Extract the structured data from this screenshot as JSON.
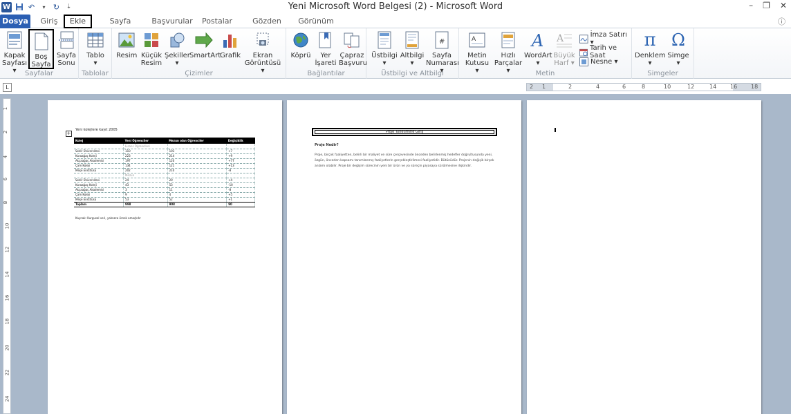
{
  "window": {
    "title": "Yeni Microsoft Word Belgesi (2) - Microsoft Word",
    "quick_access": [
      "word-logo",
      "save-icon",
      "undo-icon",
      "redo-icon",
      "customize-icon"
    ]
  },
  "tabs": [
    "Dosya",
    "Giriş",
    "Ekle",
    "Sayfa Düzeni",
    "Başvurular",
    "Postalar",
    "Gözden Geçir",
    "Görünüm"
  ],
  "active_tab": "Ekle",
  "ribbon": {
    "groups": {
      "pages": {
        "label": "Sayfalar",
        "buttons": [
          {
            "label1": "Kapak",
            "label2": "Sayfası ▾"
          },
          {
            "label1": "Boş",
            "label2": "Sayfa"
          },
          {
            "label1": "Sayfa",
            "label2": "Sonu"
          }
        ]
      },
      "tables": {
        "label": "Tablolar",
        "buttons": [
          {
            "label1": "Tablo",
            "label2": "▾"
          }
        ]
      },
      "illustrations": {
        "label": "Çizimler",
        "buttons": [
          {
            "label1": "Resim",
            "label2": ""
          },
          {
            "label1": "Küçük",
            "label2": "Resim"
          },
          {
            "label1": "Şekiller",
            "label2": "▾"
          },
          {
            "label1": "SmartArt",
            "label2": ""
          },
          {
            "label1": "Grafik",
            "label2": ""
          },
          {
            "label1": "Ekran",
            "label2": "Görüntüsü ▾"
          }
        ]
      },
      "links": {
        "label": "Bağlantılar",
        "buttons": [
          {
            "label1": "Köprü",
            "label2": ""
          },
          {
            "label1": "Yer",
            "label2": "İşareti"
          },
          {
            "label1": "Çapraz",
            "label2": "Başvuru"
          }
        ]
      },
      "header_footer": {
        "label": "Üstbilgi ve Altbilgi",
        "buttons": [
          {
            "label1": "Üstbilgi",
            "label2": "▾"
          },
          {
            "label1": "Altbilgi",
            "label2": "▾"
          },
          {
            "label1": "Sayfa",
            "label2": "Numarası ▾"
          }
        ]
      },
      "text": {
        "label": "Metin",
        "buttons": [
          {
            "label1": "Metin",
            "label2": "Kutusu ▾"
          },
          {
            "label1": "Hızlı",
            "label2": "Parçalar ▾"
          },
          {
            "label1": "WordArt",
            "label2": "▾"
          },
          {
            "label1": "Büyük",
            "label2": "Harf ▾"
          }
        ],
        "small": [
          "İmza Satırı ▾",
          "Tarih ve Saat",
          "Nesne ▾"
        ]
      },
      "symbols": {
        "label": "Simgeler",
        "buttons": [
          {
            "label1": "Denklem",
            "label2": "▾"
          },
          {
            "label1": "Simge",
            "label2": "▾"
          }
        ]
      }
    }
  },
  "ruler": {
    "ticks": [
      "2",
      "1",
      "2",
      "4",
      "6",
      "8",
      "10",
      "12",
      "14",
      "16",
      "18"
    ]
  },
  "vruler": {
    "ticks": [
      "1",
      "2",
      "4",
      "6",
      "8",
      "10",
      "12",
      "14",
      "16",
      "18",
      "20",
      "22",
      "24"
    ]
  },
  "page1": {
    "title": "Yeni kolejlere kayıt 2005",
    "columns": [
      "Kolej",
      "Yeni Öğrenciler",
      "Mezun olan Öğrenciler",
      "Değişiklik"
    ],
    "rows": [
      {
        "cells": [
          "",
          "Lisans Öğrencileri",
          "",
          ""
        ],
        "sub": true
      },
      {
        "cells": [
          "Sedir Üniversitesi",
          "110",
          "103",
          "+7"
        ]
      },
      {
        "cells": [
          "Karaağaç Koleji",
          "223",
          "214",
          "+9"
        ]
      },
      {
        "cells": [
          "Akçaağaç Akademisi",
          "197",
          "120",
          "+77"
        ]
      },
      {
        "cells": [
          "Çam Koleji",
          "134",
          "121",
          "+13"
        ]
      },
      {
        "cells": [
          "Meşe Enstitüsü",
          "202",
          "210",
          "-8"
        ]
      },
      {
        "cells": [
          "",
          "Mezun",
          "",
          ""
        ],
        "sub": true
      },
      {
        "cells": [
          "Sedir Üniversitesi",
          "24",
          "20",
          "+4"
        ]
      },
      {
        "cells": [
          "Karaağaç Koleji",
          "43",
          "53",
          "-10"
        ]
      },
      {
        "cells": [
          "Akçaağaç Akademisi",
          "3",
          "11",
          "-8"
        ]
      },
      {
        "cells": [
          "Çam Koleji",
          "9",
          "4",
          "+5"
        ]
      },
      {
        "cells": [
          "Meşe Enstitüsü",
          "53",
          "52",
          "+1"
        ]
      },
      {
        "cells": [
          "Toplam",
          "998",
          "908",
          "90"
        ],
        "total": true
      }
    ],
    "source": "Kaynak: Kurgusal veri, yalnızca örnek amaçlıdır"
  },
  "page2": {
    "heading": "Proje Yönetimine Giriş",
    "question": "Proje Nedir?",
    "body": "Proje, birçok faaliyetten, belirli bir maliyet ve süre çerçevesinde önceden belirlenmiş hedefler doğrultusunda yeni, özgün, önceden kapsamı tanımlanmış faaliyetlerin gerçekleştirilmesi faaliyetidir. Bütünüdür. Projenin değişik birçok anlamı olabilir. Proje bir değişim sürecinin yeni bir ürün ve ya süreçin piyasaya sürülmesine ilişkindir."
  }
}
